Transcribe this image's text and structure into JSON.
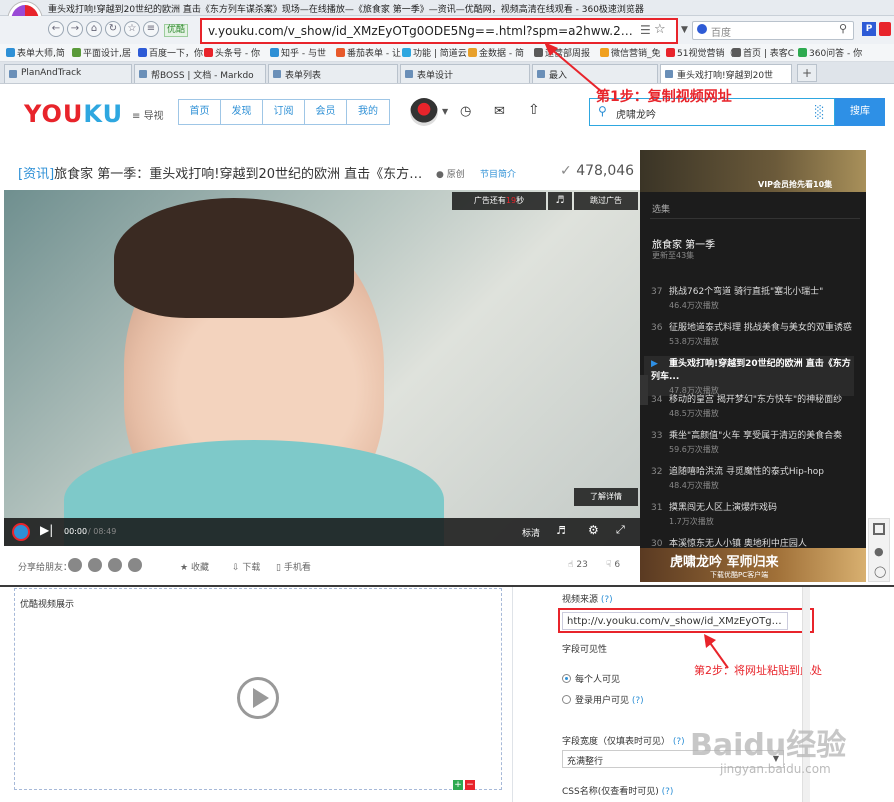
{
  "browser": {
    "window_title": "重头戏打响!穿越到20世纪的欧洲 直击《东方列车谋杀案》现场—在线播放—《旅食家 第一季》—资讯—优酷网，视频高清在线观看 - 360极速浏览器",
    "url": "v.youku.com/v_show/id_XMzEyOTg0ODE5Ng==.html?spm=a2hww.20027244.ykRecomm",
    "url_prefix_badge": "优酷",
    "search_placeholder": "百度",
    "bookmarks": [
      {
        "label": "表单大师,简",
        "color": "#2e90d6"
      },
      {
        "label": "平面设计,居",
        "color": "#5a9a3a"
      },
      {
        "label": "百度一下，你",
        "color": "#2e5bd6"
      },
      {
        "label": "头条号 - 你",
        "color": "#e8242b"
      },
      {
        "label": "知乎 - 与世",
        "color": "#2e90d6"
      },
      {
        "label": "番茄表单 - 让",
        "color": "#e85a2b"
      },
      {
        "label": "功能 | 简道云",
        "color": "#2ea7e0"
      },
      {
        "label": "金数据 - 简",
        "color": "#e8a02b"
      },
      {
        "label": "运营部周报",
        "color": "#5a5a5a"
      },
      {
        "label": "微信营销_免",
        "color": "#f0a020"
      },
      {
        "label": "51视觉营销（o",
        "color": "#e8242b"
      },
      {
        "label": "首页 | 表客C",
        "color": "#5a5a5a"
      },
      {
        "label": "360问答 - 你",
        "color": "#2eaa50"
      }
    ],
    "tabs": [
      {
        "label": "PlanAndTrack",
        "active": false
      },
      {
        "label": "帮BOSS | 文档 - Markdo",
        "active": false
      },
      {
        "label": "表单列表",
        "active": false
      },
      {
        "label": "表单设计",
        "active": false
      },
      {
        "label": "最入",
        "active": false
      },
      {
        "label": "重头戏打响!穿越到20世",
        "active": true
      }
    ]
  },
  "youku": {
    "logo_a": "YOU",
    "logo_b": "KU",
    "guide": "导视",
    "nav": [
      "首页",
      "发现",
      "订阅",
      "会员",
      "我的"
    ],
    "search_value": "虎啸龙吟",
    "search_button": "搜库",
    "video_tag": "[资讯]",
    "video_title": "旅食家 第一季：重头戏打响!穿越到20世纪的欧洲 直击《东方列车谋...",
    "original": "原创",
    "profile": "节目简介",
    "view_count": "478,046",
    "ad_remaining_pre": "广告还有",
    "ad_seconds": "19",
    "ad_remaining_post": "秒",
    "skip_ad": "跳过广告",
    "learn_more": "了解详情",
    "time_current": "00:00",
    "time_total": "/ 08:49",
    "quality": "标清",
    "share_label": "分享给朋友：",
    "actions": [
      "收藏",
      "下载",
      "手机看"
    ],
    "likes": "23",
    "dislikes": "6"
  },
  "sidebar": {
    "banner_top_text": "VIP会员抢先看10集",
    "section": "选集",
    "show_title": "旅食家 第一季",
    "updated": "更新至43集",
    "episodes": [
      {
        "num": "37",
        "title": "挑战762个弯道 骑行直抵\"塞北小瑞士\"",
        "plays": "46.4万次播放",
        "current": false
      },
      {
        "num": "36",
        "title": "征服地道泰式料理 挑战美食与美女的双重诱惑",
        "plays": "53.8万次播放",
        "current": false
      },
      {
        "num": "",
        "title": "重头戏打响!穿越到20世纪的欧洲 直击《东方列车...",
        "plays": "47.8万次播放",
        "current": true
      },
      {
        "num": "34",
        "title": "移动的皇宫 揭开梦幻\"东方快车\"的神秘面纱",
        "plays": "48.5万次播放",
        "current": false
      },
      {
        "num": "33",
        "title": "乘坐\"高颜值\"火车 享受属于清迈的美食合奏",
        "plays": "59.6万次播放",
        "current": false
      },
      {
        "num": "32",
        "title": "追随嘻哈洪流 寻觅魔性的泰式Hip-hop",
        "plays": "48.4万次播放",
        "current": false
      },
      {
        "num": "31",
        "title": "摸黑闯无人区上演爆炸戏码",
        "plays": "1.7万次播放",
        "current": false
      },
      {
        "num": "30",
        "title": "本溪惊东无人小镇 奥地利中庄园人",
        "plays": "",
        "current": false
      }
    ],
    "banner_bottom_title": "虎啸龙吟 军师归来",
    "banner_bottom_sub": "下载优酷PC客户端"
  },
  "annotations": {
    "step1": "第1步：复制视频网址",
    "step2": "第2步：将网址粘贴到此处"
  },
  "form": {
    "panel_title": "优酷视频展示",
    "source_label": "视频来源",
    "help": "(?)",
    "url_value": "http://v.youku.com/v_show/id_XMzEyOTg0ODE5",
    "visibility_label": "字段可见性",
    "visibility_options": [
      {
        "label": "每个人可见",
        "selected": true
      },
      {
        "label": "登录用户可见",
        "selected": false
      }
    ],
    "width_label": "字段宽度（仅填表时可见）",
    "width_value": "充满整行",
    "css_label": "CSS名称(仅查看时可见)"
  },
  "watermark": {
    "brand": "Baidu经验",
    "site": "jingyan.baidu.com"
  }
}
